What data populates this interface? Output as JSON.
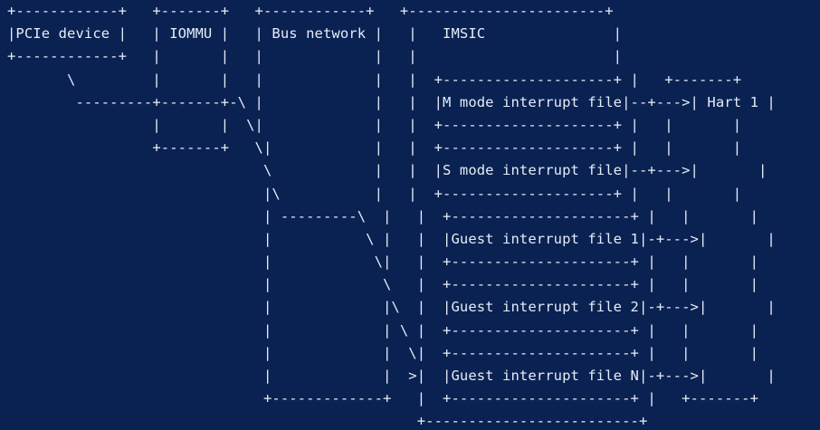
{
  "diagram": {
    "lines": [
      "+------------+   +-------+   +------------+   +-----------------------+",
      "|PCIe device |   | IOMMU |   | Bus network |   |   IMSIC               |",
      "+------------+   |       |   |             |   |                       |",
      "       \\         |       |   |             |   |  +--------------------+ |   +-------+",
      "        ---------+-------+-\\ |             |   |  |M mode interrupt file|--+--->| Hart 1 |",
      "                 |       |  \\|             |   |  +--------------------+ |   |       |",
      "                 +-------+   \\|            |   |  +--------------------+ |   |       |",
      "                              \\            |   |  |S mode interrupt file|--+--->|       |",
      "                              |\\           |   |  +--------------------+ |   |       |",
      "                              | ---------\\  |   |  +---------------------+ |   |       |",
      "                              |           \\ |   |  |Guest interrupt file 1|-+--->|       |",
      "                              |            \\|   |  +---------------------+ |   |       |",
      "                              |             \\   |  +---------------------+ |   |       |",
      "                              |             |\\  |  |Guest interrupt file 2|-+--->|       |",
      "                              |             | \\ |  +---------------------+ |   |       |",
      "                              |             |  \\|  +---------------------+ |   |       |",
      "                              |             |  >|  |Guest interrupt file N|-+--->|       |",
      "                              +-------------+   |  +---------------------+ |   +-------+",
      "                                                +-------------------------+"
    ]
  }
}
